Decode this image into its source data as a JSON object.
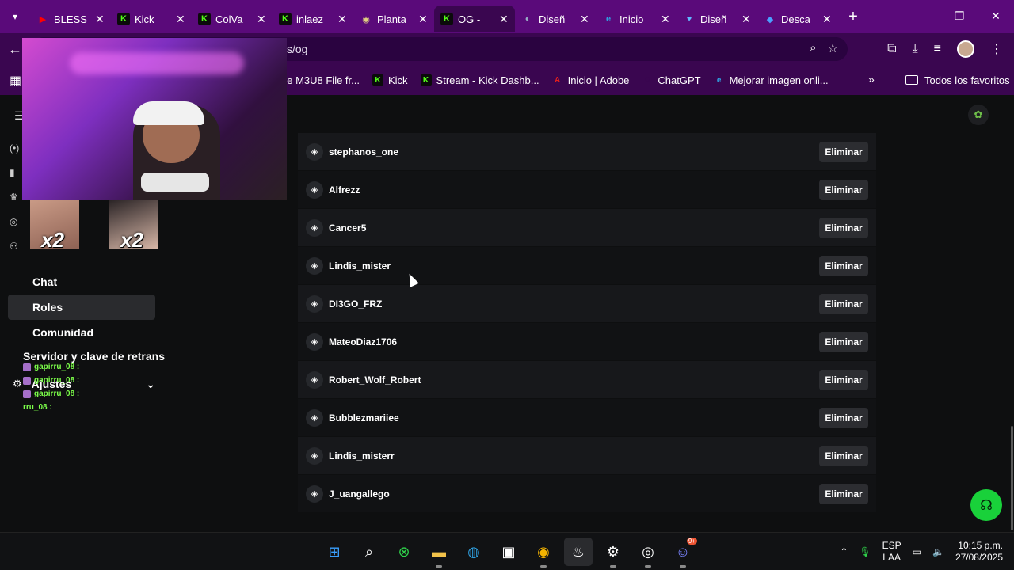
{
  "tabs": [
    {
      "label": "BLESS",
      "icon": "youtube-icon",
      "color": "#ff0000",
      "glyph": "▶"
    },
    {
      "label": "Kick",
      "icon": "kick-icon",
      "color": "#53fc18",
      "glyph": "K"
    },
    {
      "label": "ColVa",
      "icon": "kick-icon",
      "color": "#53fc18",
      "glyph": "K"
    },
    {
      "label": "inlaez",
      "icon": "kick-icon",
      "color": "#53fc18",
      "glyph": "K"
    },
    {
      "label": "Planta",
      "icon": "plant-icon",
      "color": "#e0d080",
      "glyph": "◉"
    },
    {
      "label": "OG - ",
      "icon": "kick-icon",
      "color": "#53fc18",
      "glyph": "K"
    },
    {
      "label": "Diseñ",
      "icon": "globe-icon",
      "color": "#9ab0c8",
      "glyph": "◐"
    },
    {
      "label": "Inicio",
      "icon": "edge-icon",
      "color": "#2fa0e0",
      "glyph": "e"
    },
    {
      "label": "Diseñ",
      "icon": "heart-icon",
      "color": "#60b8ff",
      "glyph": "♥"
    },
    {
      "label": "Desca",
      "icon": "diamond-icon",
      "color": "#4aa0ff",
      "glyph": "◆"
    }
  ],
  "address": {
    "url": "s/og"
  },
  "bookmarks": [
    {
      "label": "he M3U8 File fr...",
      "icon": "file-icon",
      "color": "#3a0650",
      "glyph": ""
    },
    {
      "label": "Kick",
      "icon": "kick-icon",
      "color": "#53fc18",
      "glyph": "K"
    },
    {
      "label": "Stream - Kick Dashb...",
      "icon": "kick-icon",
      "color": "#53fc18",
      "glyph": "K"
    },
    {
      "label": "Inicio | Adobe",
      "icon": "adobe-icon",
      "color": "#e41e1e",
      "glyph": "A"
    },
    {
      "label": "ChatGPT",
      "icon": "chatgpt-icon",
      "color": "#3a0650",
      "glyph": "✺"
    },
    {
      "label": "Mejorar imagen onli...",
      "icon": "edge-icon",
      "color": "#2fa0e0",
      "glyph": "e"
    }
  ],
  "bookmarks_all": "Todos los favoritos",
  "sidebar": {
    "items": [
      "Chat",
      "Roles",
      "Comunidad"
    ],
    "selected": "Roles",
    "section": "Servidor y clave de retrans",
    "settings": "Ajustes"
  },
  "roles": {
    "button_label": "Eliminar",
    "users": [
      {
        "name": "stephanos_one"
      },
      {
        "name": "Alfrezz"
      },
      {
        "name": "Cancer5"
      },
      {
        "name": "Lindis_mister"
      },
      {
        "name": "DI3GO_FRZ"
      },
      {
        "name": "MateoDiaz1706"
      },
      {
        "name": "Robert_Wolf_Robert"
      },
      {
        "name": "Bubblezmariiee"
      },
      {
        "name": "Lindis_misterr"
      },
      {
        "name": "J_uangallego"
      }
    ]
  },
  "overlay": {
    "multiplier_1": "x2",
    "multiplier_2": "x2",
    "chat_lines": [
      "gapirru_08 :",
      "gapirru_08 :",
      "gapirru_08 :",
      "rru_08 :"
    ]
  },
  "taskbar": {
    "lang_1": "ESP",
    "lang_2": "LAA",
    "time": "10:15 p.m.",
    "date": "27/08/2025",
    "discord_badge": "9+"
  }
}
